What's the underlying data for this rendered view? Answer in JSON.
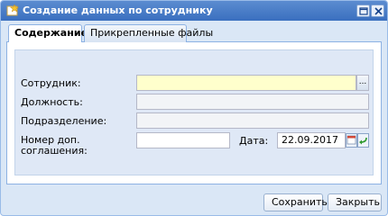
{
  "window": {
    "title": "Создание данных по сотруднику"
  },
  "tabs": [
    {
      "label": "Содержание",
      "active": true
    },
    {
      "label": "Прикрепленные файлы",
      "active": false
    }
  ],
  "form": {
    "employee_label": "Сотрудник:",
    "employee_value": "",
    "employee_trigger": "...",
    "position_label": "Должность:",
    "position_value": "",
    "department_label": "Подразделение:",
    "department_value": "",
    "agreement_label_line1": "Номер доп.",
    "agreement_label_line2": "соглашения:",
    "agreement_value": "",
    "date_label": "Дата:",
    "date_value": "22.09.2017"
  },
  "footer": {
    "save_label": "Сохранить",
    "close_label": "Закрыть"
  },
  "colors": {
    "title_bar": "#3a6fbf",
    "window_bg": "#dae7f6",
    "required_field": "#ffffcc"
  }
}
